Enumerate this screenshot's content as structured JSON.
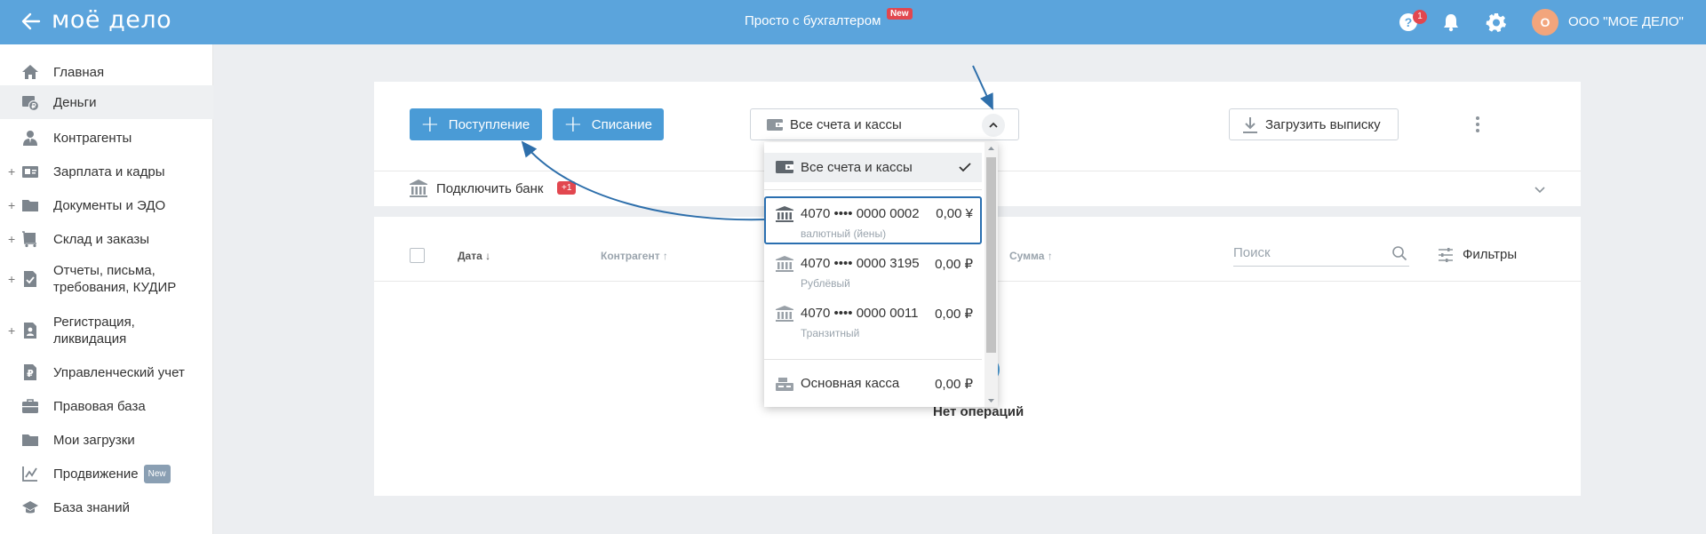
{
  "header": {
    "logo_text": "моё дело",
    "promo_text": "Просто с бухгалтером",
    "promo_badge": "New",
    "help_count": "1",
    "org_initial": "О",
    "org_name": "ООО \"МОЕ ДЕЛО\""
  },
  "sidebar": {
    "items": [
      {
        "label": "Главная",
        "icon": "home-icon"
      },
      {
        "label": "Деньги",
        "icon": "wallet-icon"
      },
      {
        "label": "Контрагенты",
        "icon": "person-icon"
      },
      {
        "label": "Зарплата и кадры",
        "icon": "id-card-icon"
      },
      {
        "label": "Документы и ЭДО",
        "icon": "folder-icon"
      },
      {
        "label": "Склад и заказы",
        "icon": "cart-icon"
      },
      {
        "label": "Отчеты, письма,",
        "label2": "требования, КУДИР",
        "icon": "report-icon"
      },
      {
        "label": "Регистрация,",
        "label2": "ликвидация",
        "icon": "registration-icon"
      },
      {
        "label": "Управленческий учет",
        "icon": "ruble-doc-icon"
      },
      {
        "label": "Правовая база",
        "icon": "briefcase-icon"
      },
      {
        "label": "Мои загрузки",
        "icon": "folder-icon"
      },
      {
        "label": "Продвижение",
        "badge": "New",
        "icon": "chart-icon"
      },
      {
        "label": "База знаний",
        "icon": "graduation-cap-icon"
      }
    ]
  },
  "toolbar": {
    "income_label": "Поступление",
    "expense_label": "Списание",
    "account_select_label": "Все счета и кассы",
    "upload_label": "Загрузить выписку"
  },
  "bank": {
    "connect_label": "Подключить банк",
    "badge": "+1"
  },
  "table": {
    "headers": {
      "date": "Дата ↓",
      "counterparty": "Контрагент ↑",
      "sum": "Сумма ↑"
    },
    "search_placeholder": "Поиск",
    "filters_label": "Фильтры",
    "empty_text": "Нет операций"
  },
  "dropdown": {
    "all_label": "Все счета и кассы",
    "accounts": [
      {
        "number": "4070 •••• 0000 0002",
        "type": "валютный (йены)",
        "amount": "0,00 ¥"
      },
      {
        "number": "4070 •••• 0000 3195",
        "type": "Рублёвый",
        "amount": "0,00 ₽"
      },
      {
        "number": "4070 •••• 0000 0011",
        "type": "Транзитный",
        "amount": "0,00 ₽"
      }
    ],
    "cash": {
      "name": "Основная касса",
      "amount": "0,00 ₽"
    }
  },
  "colors": {
    "topbar": "#5ba4dc",
    "primary_button": "#4a9bd6",
    "badge_red": "#e2474f",
    "highlight_border": "#2a6fb0",
    "arrow": "#2e6fab"
  }
}
